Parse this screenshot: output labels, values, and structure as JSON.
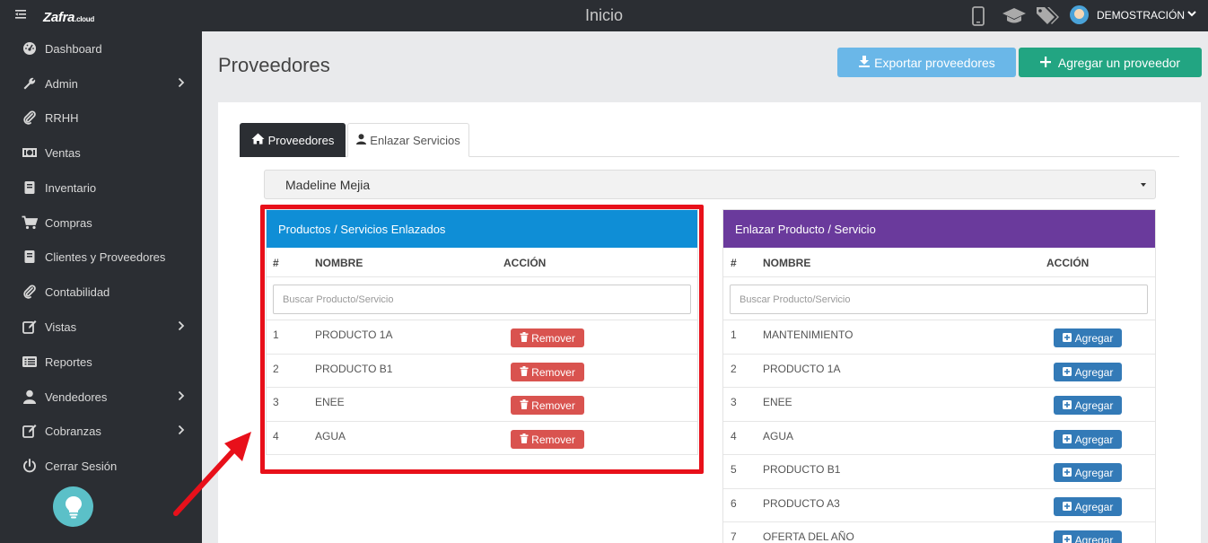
{
  "topbar": {
    "logo": "Zafra",
    "logo_suffix": ".cloud",
    "title": "Inicio",
    "user_name": "DEMOSTRACIÓN"
  },
  "sidebar": {
    "items": [
      {
        "label": "Dashboard",
        "icon": "dashboard-icon",
        "arrow": false
      },
      {
        "label": "Admin",
        "icon": "wrench-icon",
        "arrow": true
      },
      {
        "label": "RRHH",
        "icon": "paperclip-icon",
        "arrow": false
      },
      {
        "label": "Ventas",
        "icon": "money-icon",
        "arrow": false
      },
      {
        "label": "Inventario",
        "icon": "book-icon",
        "arrow": false
      },
      {
        "label": "Compras",
        "icon": "cart-icon",
        "arrow": false
      },
      {
        "label": "Clientes y Proveedores",
        "icon": "book-icon",
        "arrow": false
      },
      {
        "label": "Contabilidad",
        "icon": "paperclip-icon",
        "arrow": false
      },
      {
        "label": "Vistas",
        "icon": "edit-icon",
        "arrow": true
      },
      {
        "label": "Reportes",
        "icon": "list-icon",
        "arrow": false
      },
      {
        "label": "Vendedores",
        "icon": "user-icon",
        "arrow": true
      },
      {
        "label": "Cobranzas",
        "icon": "edit-icon",
        "arrow": true
      },
      {
        "label": "Cerrar Sesión",
        "icon": "power-icon",
        "arrow": false
      }
    ]
  },
  "page": {
    "title": "Proveedores",
    "export_button": "Exportar proveedores",
    "add_button": "Agregar un proveedor"
  },
  "tabs": [
    {
      "label": "Proveedores",
      "active": true
    },
    {
      "label": "Enlazar Servicios",
      "active": false
    }
  ],
  "provider_select": {
    "value": "Madeline Mejia"
  },
  "linked_panel": {
    "title": "Productos / Servicios Enlazados",
    "header_color": "#0f8ed6",
    "columns": [
      "#",
      "NOMBRE",
      "ACCIÓN"
    ],
    "search_placeholder": "Buscar Producto/Servicio",
    "action_label": "Remover",
    "rows": [
      {
        "num": "1",
        "name": "PRODUCTO 1A"
      },
      {
        "num": "2",
        "name": "PRODUCTO B1"
      },
      {
        "num": "3",
        "name": "ENEE"
      },
      {
        "num": "4",
        "name": "AGUA"
      }
    ]
  },
  "link_panel": {
    "title": "Enlazar Producto / Servicio",
    "header_color": "#6a3a9c",
    "columns": [
      "#",
      "NOMBRE",
      "ACCIÓN"
    ],
    "search_placeholder": "Buscar Producto/Servicio",
    "action_label": "Agregar",
    "rows": [
      {
        "num": "1",
        "name": "MANTENIMIENTO"
      },
      {
        "num": "2",
        "name": "PRODUCTO 1A"
      },
      {
        "num": "3",
        "name": "ENEE"
      },
      {
        "num": "4",
        "name": "AGUA"
      },
      {
        "num": "5",
        "name": "PRODUCTO B1"
      },
      {
        "num": "6",
        "name": "PRODUCTO A3"
      },
      {
        "num": "7",
        "name": "OFERTA DEL AÑO"
      }
    ]
  },
  "colors": {
    "export_button": "#6ab7e8",
    "add_button": "#22a582",
    "remove_button": "#d9534f",
    "agregar_button": "#337ab7",
    "highlight": "#e8101a"
  }
}
